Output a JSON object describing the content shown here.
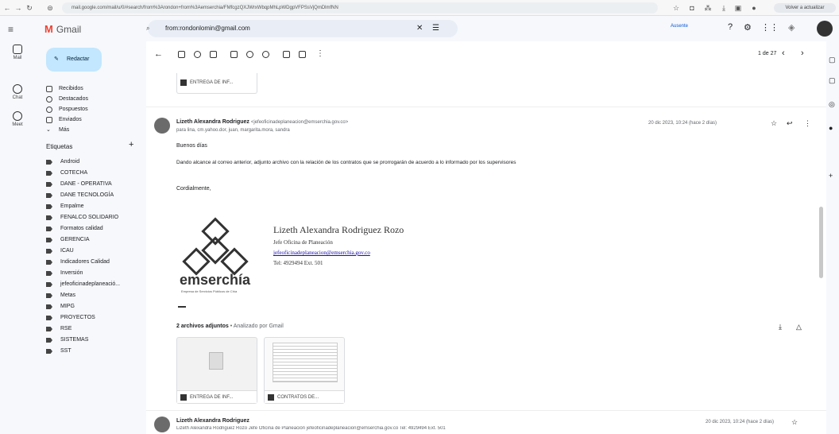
{
  "browser": {
    "url": "mail.google.com/mail/u/0/#search/from%3Arondon+from%3Aemserchia/FMfcgzQXJWrxWbqpMhLpWDgpVFPSsVjQmDlmfNN",
    "update_label": "Volver a actualizar"
  },
  "app": {
    "title": "Gmail",
    "search_query": "from:rondonlomin@gmail.com",
    "status": "Ausente",
    "pager": "1 de 27"
  },
  "rail": [
    {
      "label": "Mail"
    },
    {
      "label": "Chat"
    },
    {
      "label": "Meet"
    }
  ],
  "sidebar": {
    "compose": "Redactar",
    "nav": [
      {
        "label": "Recibidos"
      },
      {
        "label": "Destacados"
      },
      {
        "label": "Pospuestos"
      },
      {
        "label": "Enviados"
      },
      {
        "label": "Más"
      }
    ],
    "labels_title": "Etiquetas",
    "labels": [
      "Android",
      "COTECHA",
      "DANE - OPERATIVA",
      "DANE TECNOLOGÍA",
      "Empalme",
      "FENALCO SOLIDARIO",
      "Formatos calidad",
      "GERENCIA",
      "ICAU",
      "Indicadores Calidad",
      "Inversión",
      "jefeoficinadeplaneació...",
      "Metas",
      "MIPG",
      "PROYECTOS",
      "RSE",
      "SISTEMAS",
      "SST"
    ]
  },
  "message1": {
    "attachment": "ENTREGA DE INF..."
  },
  "message2": {
    "sender": "Lizeth Alexandra Rodriguez",
    "sender_email": "<jefeoficinadeplaneacion@emserchia.gov.co>",
    "to": "para lina, cm.yahoo.dor, juan, margarita.mora, sandra",
    "date": "20 dic 2023, 10:24 (hace 2 días)",
    "greeting": "Buenos días",
    "body": "Dando alcance al correo anterior, adjunto archivo con la relación de los contratos que se prorrogarán de acuerdo a lo informado por los supervisores",
    "closing": "Cordialmente,",
    "sig_name": "Lizeth Alexandra Rodriguez Rozo",
    "sig_title": "Jefe Oficina de Planeación",
    "sig_email": "jefeoficinadeplaneacion@emserchia.gov.co",
    "sig_phone": "Tel: 4929494 Ext. 501",
    "logo_text": "emserchía",
    "logo_sub": "Empresa de Servicios Públicos de Chía",
    "attachments_title": "2 archivos adjuntos",
    "scanned": "• Analizado por Gmail",
    "attachments": [
      "ENTREGA DE INF...",
      "CONTRATOS DE..."
    ]
  },
  "message3": {
    "sender": "Lizeth Alexandra Rodriguez",
    "snippet": "Lizeth Alexandra Rodriguez Rozo Jefe Oficina de Planeación jefeoficinadeplaneacion@emserchia.gov.co Tel: 4929494 Ext. 501",
    "date": "20 dic 2023, 10:24 (hace 2 días)"
  }
}
